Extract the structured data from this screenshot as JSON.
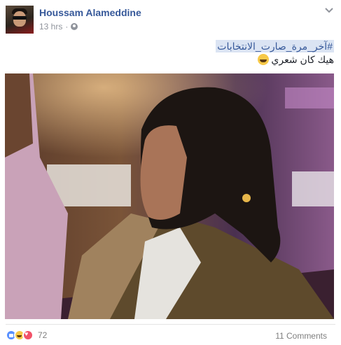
{
  "post": {
    "author": "Houssam Alameddine",
    "timestamp": "13 hrs",
    "separator": "·",
    "privacy_icon": "globe-icon",
    "options_icon": "chevron-down-icon",
    "hashtag": "#آخر_مرة_صارت_الانتخابات",
    "caption": "هيك كان شعري",
    "caption_emoji": "laughing-emoji"
  },
  "footer": {
    "reaction_icons": [
      "like-icon",
      "haha-icon",
      "love-icon"
    ],
    "reaction_count": "72",
    "comments_count": "11 Comments"
  },
  "colors": {
    "author_link": "#365899",
    "meta_text": "#90949c",
    "hashtag_bg": "#dbe4f3",
    "like": "#5890ff",
    "haha": "#f7c948",
    "love": "#f25268"
  }
}
